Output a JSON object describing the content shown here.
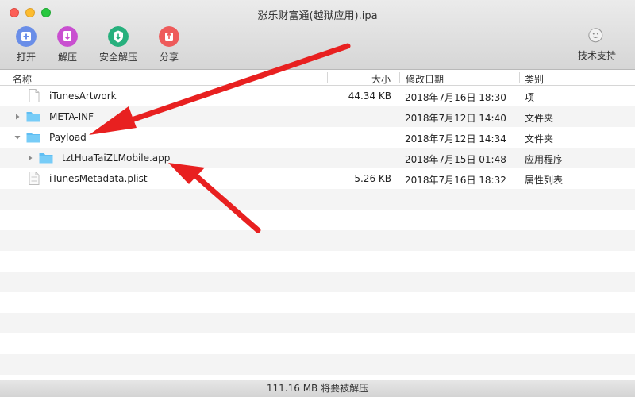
{
  "window": {
    "title": "涨乐财富通(越狱应用).ipa"
  },
  "toolbar": {
    "open": "打开",
    "extract": "解压",
    "safe_extract": "安全解压",
    "share": "分享",
    "support": "技术支持"
  },
  "columns": {
    "name": "名称",
    "size": "大小",
    "modified": "修改日期",
    "kind": "类别"
  },
  "files": [
    {
      "name": "iTunesArtwork",
      "size": "44.34 KB",
      "modified": "2018年7月16日 18:30",
      "kind": "项"
    },
    {
      "name": "META-INF",
      "size": "",
      "modified": "2018年7月12日 14:40",
      "kind": "文件夹"
    },
    {
      "name": "Payload",
      "size": "",
      "modified": "2018年7月12日 14:34",
      "kind": "文件夹"
    },
    {
      "name": "tztHuaTaiZLMobile.app",
      "size": "",
      "modified": "2018年7月15日 01:48",
      "kind": "应用程序"
    },
    {
      "name": "iTunesMetadata.plist",
      "size": "5.26 KB",
      "modified": "2018年7月16日 18:32",
      "kind": "属性列表"
    }
  ],
  "status": {
    "text": "111.16 MB 将要被解压"
  },
  "colors": {
    "open_icon": "#6a8ee8",
    "extract_icon": "#c94fd0",
    "safe_icon": "#27b07d",
    "share_icon": "#ee5b5b",
    "folder": "#5fbef3",
    "arrow": "#e82020"
  },
  "icons": {
    "open": "plus-square-icon",
    "extract": "extract-icon",
    "safe_extract": "shield-icon",
    "share": "share-icon",
    "support": "support-face-icon"
  }
}
